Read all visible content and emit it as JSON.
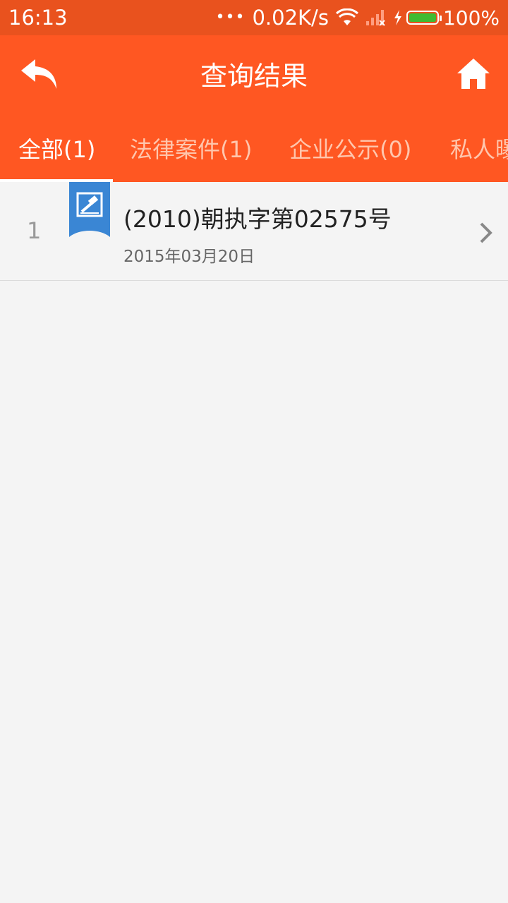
{
  "status_bar": {
    "time": "16:13",
    "dots": "•••",
    "speed": "0.02K/s",
    "battery": "100%",
    "icons": [
      "wifi-icon",
      "signal-icon",
      "charge-icon",
      "battery-icon"
    ],
    "battery_color": "#3fbb32"
  },
  "header": {
    "title": "查询结果",
    "back_icon": "reply-arrow-icon",
    "home_icon": "home-icon",
    "background": "#ff5722"
  },
  "tabs": [
    {
      "label": "全部(1)",
      "active": true
    },
    {
      "label": "法律案件(1)",
      "active": false
    },
    {
      "label": "企业公示(0)",
      "active": false
    },
    {
      "label": "私人曝",
      "active": false
    }
  ],
  "results": [
    {
      "index": "1",
      "title": "(2010)朝执字第02575号",
      "date": "2015年03月20日",
      "badge_icon": "gavel-icon",
      "badge_color": "#3a86d4"
    }
  ]
}
